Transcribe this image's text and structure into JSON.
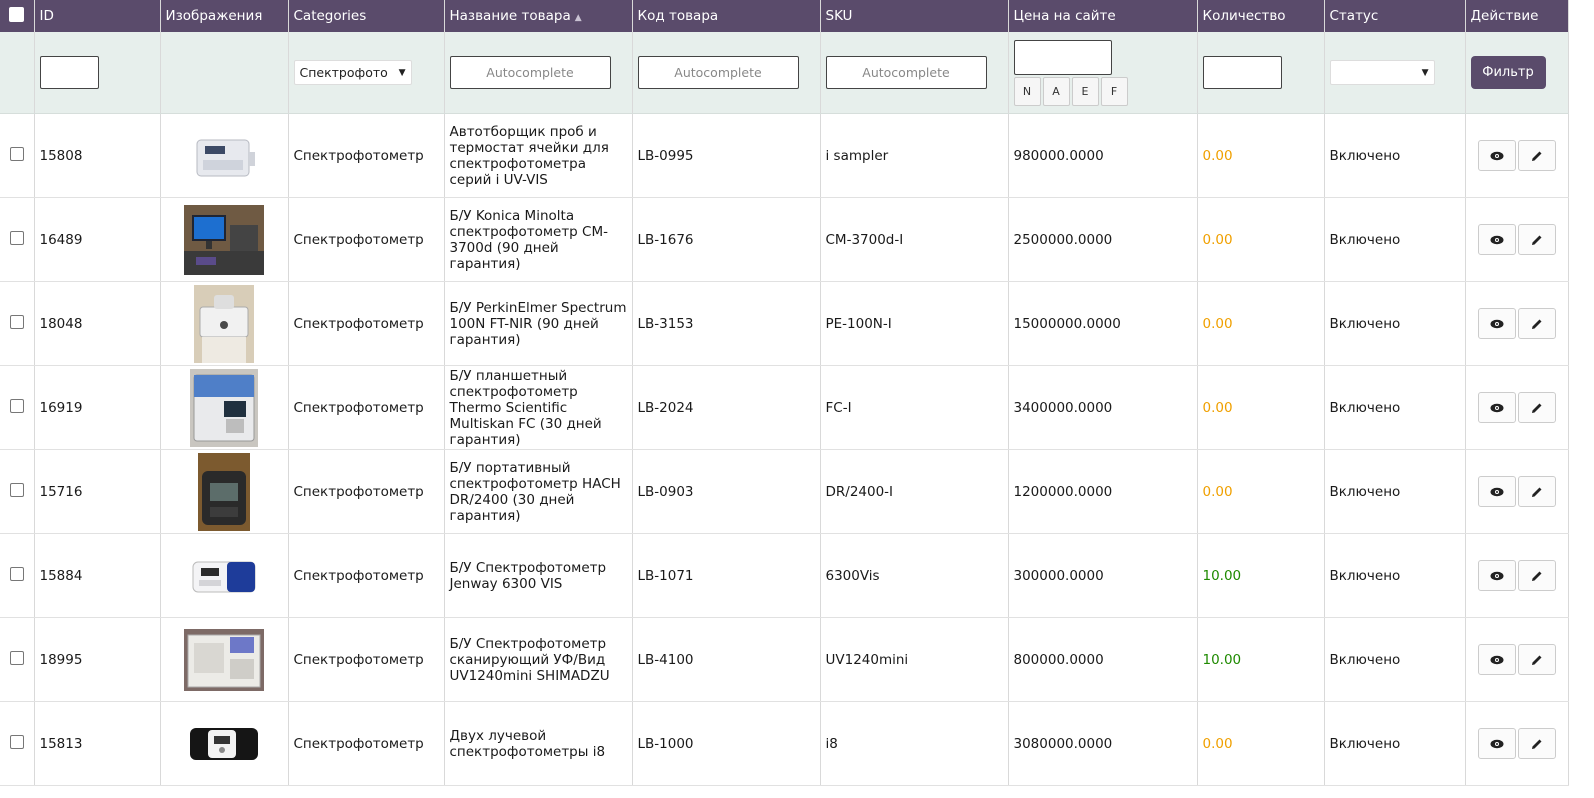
{
  "columns": [
    "ID",
    "Изображения",
    "Categories",
    "Название товара",
    "Код товара",
    "SKU",
    "Цена на сайте",
    "Количество",
    "Статус",
    "Действие"
  ],
  "sort_icon": "▲",
  "filters": {
    "category_value": "Спектрофото",
    "autocomplete_placeholder": "Autocomplete",
    "price_buttons": [
      "N",
      "A",
      "E",
      "F"
    ],
    "filter_button": "Фильтр"
  },
  "colors": {
    "header": "#5a4b6b",
    "filter_bg": "#e7efec",
    "qty_low": "#f0a000",
    "qty_ok": "#1f8a00"
  },
  "rows": [
    {
      "id": "15808",
      "category": "Спектрофотометр",
      "name": "Автотборщик проб и термостат ячейки для спектрофотометра серий i UV-VIS",
      "code": "LB-0995",
      "sku": "i sampler",
      "price": "980000.0000",
      "qty": "0.00",
      "status": "Включено"
    },
    {
      "id": "16489",
      "category": "Спектрофотометр",
      "name": "Б/У Konica Minolta спектрофотометр CM-3700d (90 дней гарантия)",
      "code": "LB-1676",
      "sku": "CM-3700d-I",
      "price": "2500000.0000",
      "qty": "0.00",
      "status": "Включено"
    },
    {
      "id": "18048",
      "category": "Спектрофотометр",
      "name": "Б/У PerkinElmer Spectrum 100N FT-NIR (90 дней гарантия)",
      "code": "LB-3153",
      "sku": "PE-100N-I",
      "price": "15000000.0000",
      "qty": "0.00",
      "status": "Включено"
    },
    {
      "id": "16919",
      "category": "Спектрофотометр",
      "name": "Б/У планшетный спектрофотометр Thermo Scientific Multiskan FC (30 дней гарантия)",
      "code": "LB-2024",
      "sku": "FC-I",
      "price": "3400000.0000",
      "qty": "0.00",
      "status": "Включено"
    },
    {
      "id": "15716",
      "category": "Спектрофотометр",
      "name": "Б/У портативный спектрофотометр HACH DR/2400 (30 дней гарантия)",
      "code": "LB-0903",
      "sku": "DR/2400-I",
      "price": "1200000.0000",
      "qty": "0.00",
      "status": "Включено"
    },
    {
      "id": "15884",
      "category": "Спектрофотометр",
      "name": "Б/У Спектрофотометр Jenway 6300 VIS",
      "code": "LB-1071",
      "sku": "6300Vis",
      "price": "300000.0000",
      "qty": "10.00",
      "status": "Включено"
    },
    {
      "id": "18995",
      "category": "Спектрофотометр",
      "name": "Б/У Спектрофотометр сканирующий УФ/Вид UV1240mini  SHIMADZU",
      "code": "LB-4100",
      "sku": "UV1240mini",
      "price": "800000.0000",
      "qty": "10.00",
      "status": "Включено"
    },
    {
      "id": "15813",
      "category": "Спектрофотометр",
      "name": "Двух лучевой спектрофотометры i8",
      "code": "LB-1000",
      "sku": "i8",
      "price": "3080000.0000",
      "qty": "0.00",
      "status": "Включено"
    }
  ]
}
